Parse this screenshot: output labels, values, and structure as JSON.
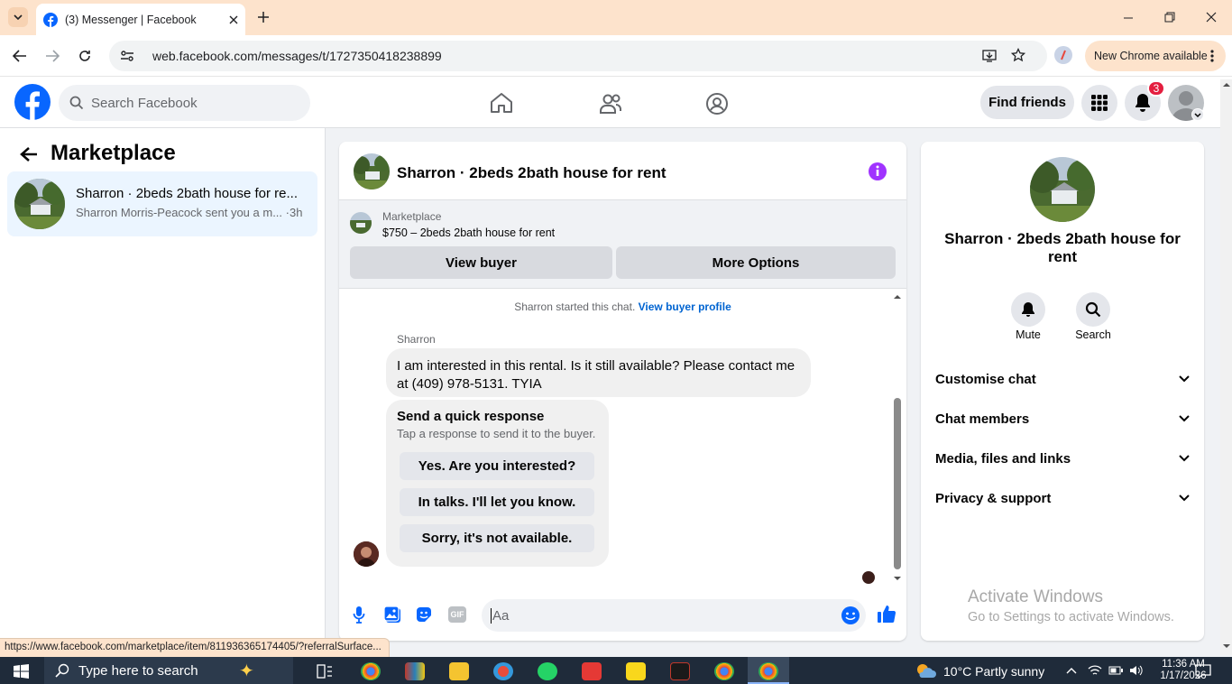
{
  "browser": {
    "tab_title": "(3) Messenger | Facebook",
    "url": "web.facebook.com/messages/t/1727350418238899",
    "update_label": "New Chrome available"
  },
  "fb_header": {
    "search_placeholder": "Search Facebook",
    "find_friends": "Find friends",
    "notification_count": "3"
  },
  "left_panel": {
    "title": "Marketplace",
    "conversation": {
      "name": "Sharron · 2beds 2bath house for re...",
      "preview": "Sharron Morris-Peacock sent you a m...",
      "time": "·3h"
    }
  },
  "chat": {
    "header_title": "Sharron · 2beds 2bath house for rent",
    "listing_label": "Marketplace",
    "listing_detail": "$750 – 2beds 2bath house for rent",
    "view_buyer": "View buyer",
    "more_options": "More Options",
    "started_text": "Sharron started this chat.",
    "view_profile_link": "View buyer profile",
    "sender_name": "Sharron",
    "message_line1": "I am interested in this rental. Is it still available?  Please contact me",
    "message_line2": "at (409) 978-5131. TYIA",
    "quick_title": "Send a quick response",
    "quick_subtitle": "Tap a response to send it to the buyer.",
    "quick_responses": [
      "Yes. Are you interested?",
      "In talks. I'll let you know.",
      "Sorry, it's not available."
    ],
    "composer_placeholder": "Aa"
  },
  "right_panel": {
    "name_line1": "Sharron · 2beds 2bath house for",
    "name_line2": "rent",
    "mute": "Mute",
    "search": "Search",
    "sections": [
      "Customise chat",
      "Chat members",
      "Media, files and links",
      "Privacy & support"
    ],
    "watermark_title": "Activate Windows",
    "watermark_sub": "Go to Settings to activate Windows."
  },
  "status_url": "https://www.facebook.com/marketplace/item/811936365174405/?referralSurface...",
  "taskbar": {
    "search_placeholder": "Type here to search",
    "weather": "10°C  Partly sunny",
    "time": "11:36 AM",
    "date": "1/17/2026"
  },
  "colors": {
    "fb_blue": "#0866ff",
    "messenger_purple": "#a033ff",
    "link": "#0064d1"
  }
}
